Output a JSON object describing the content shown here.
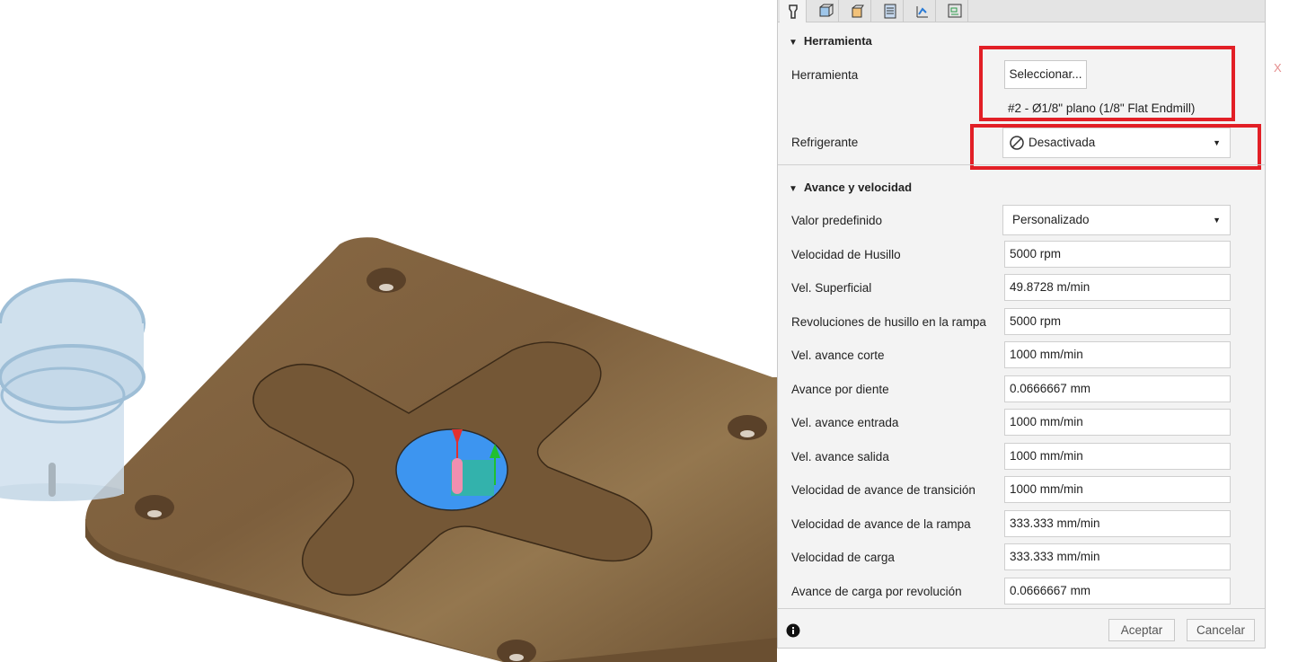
{
  "viewport": {
    "axis_label": "X"
  },
  "panel": {
    "tabs": [
      {
        "icon": "tool-icon",
        "active": true
      },
      {
        "icon": "geometry-icon",
        "active": false
      },
      {
        "icon": "heights-icon",
        "active": false
      },
      {
        "icon": "passes-icon",
        "active": false
      },
      {
        "icon": "linking-icon",
        "active": false
      },
      {
        "icon": "post-icon",
        "active": false
      }
    ],
    "tool_section": {
      "title": "Herramienta",
      "tool_label": "Herramienta",
      "select_button": "Seleccionar...",
      "tool_description": "#2 - Ø1/8\" plano (1/8\" Flat Endmill)",
      "coolant_label": "Refrigerante",
      "coolant_value": "Desactivada"
    },
    "feed_section": {
      "title": "Avance y velocidad",
      "preset_label": "Valor predefinido",
      "preset_value": "Personalizado",
      "rows": [
        {
          "label": "Velocidad de Husillo",
          "value": "5000 rpm"
        },
        {
          "label": "Vel. Superficial",
          "value": "49.8728 m/min"
        },
        {
          "label": "Revoluciones de husillo en la rampa",
          "value": "5000 rpm"
        },
        {
          "label": "Vel. avance corte",
          "value": "1000 mm/min"
        },
        {
          "label": "Avance por diente",
          "value": "0.0666667 mm"
        },
        {
          "label": "Vel. avance entrada",
          "value": "1000 mm/min"
        },
        {
          "label": "Vel. avance salida",
          "value": "1000 mm/min"
        },
        {
          "label": "Velocidad de avance de transición",
          "value": "1000 mm/min"
        },
        {
          "label": "Velocidad de avance de la rampa",
          "value": "333.333 mm/min"
        },
        {
          "label": "Velocidad de carga",
          "value": "333.333 mm/min"
        },
        {
          "label": "Avance de carga por revolución",
          "value": "0.0666667 mm"
        }
      ]
    },
    "footer": {
      "ok": "Aceptar",
      "cancel": "Cancelar",
      "info_icon": "info-icon"
    }
  },
  "colors": {
    "highlight": "#e21f26",
    "wood": "#7a5c3a",
    "selection": "#3d95f0"
  }
}
